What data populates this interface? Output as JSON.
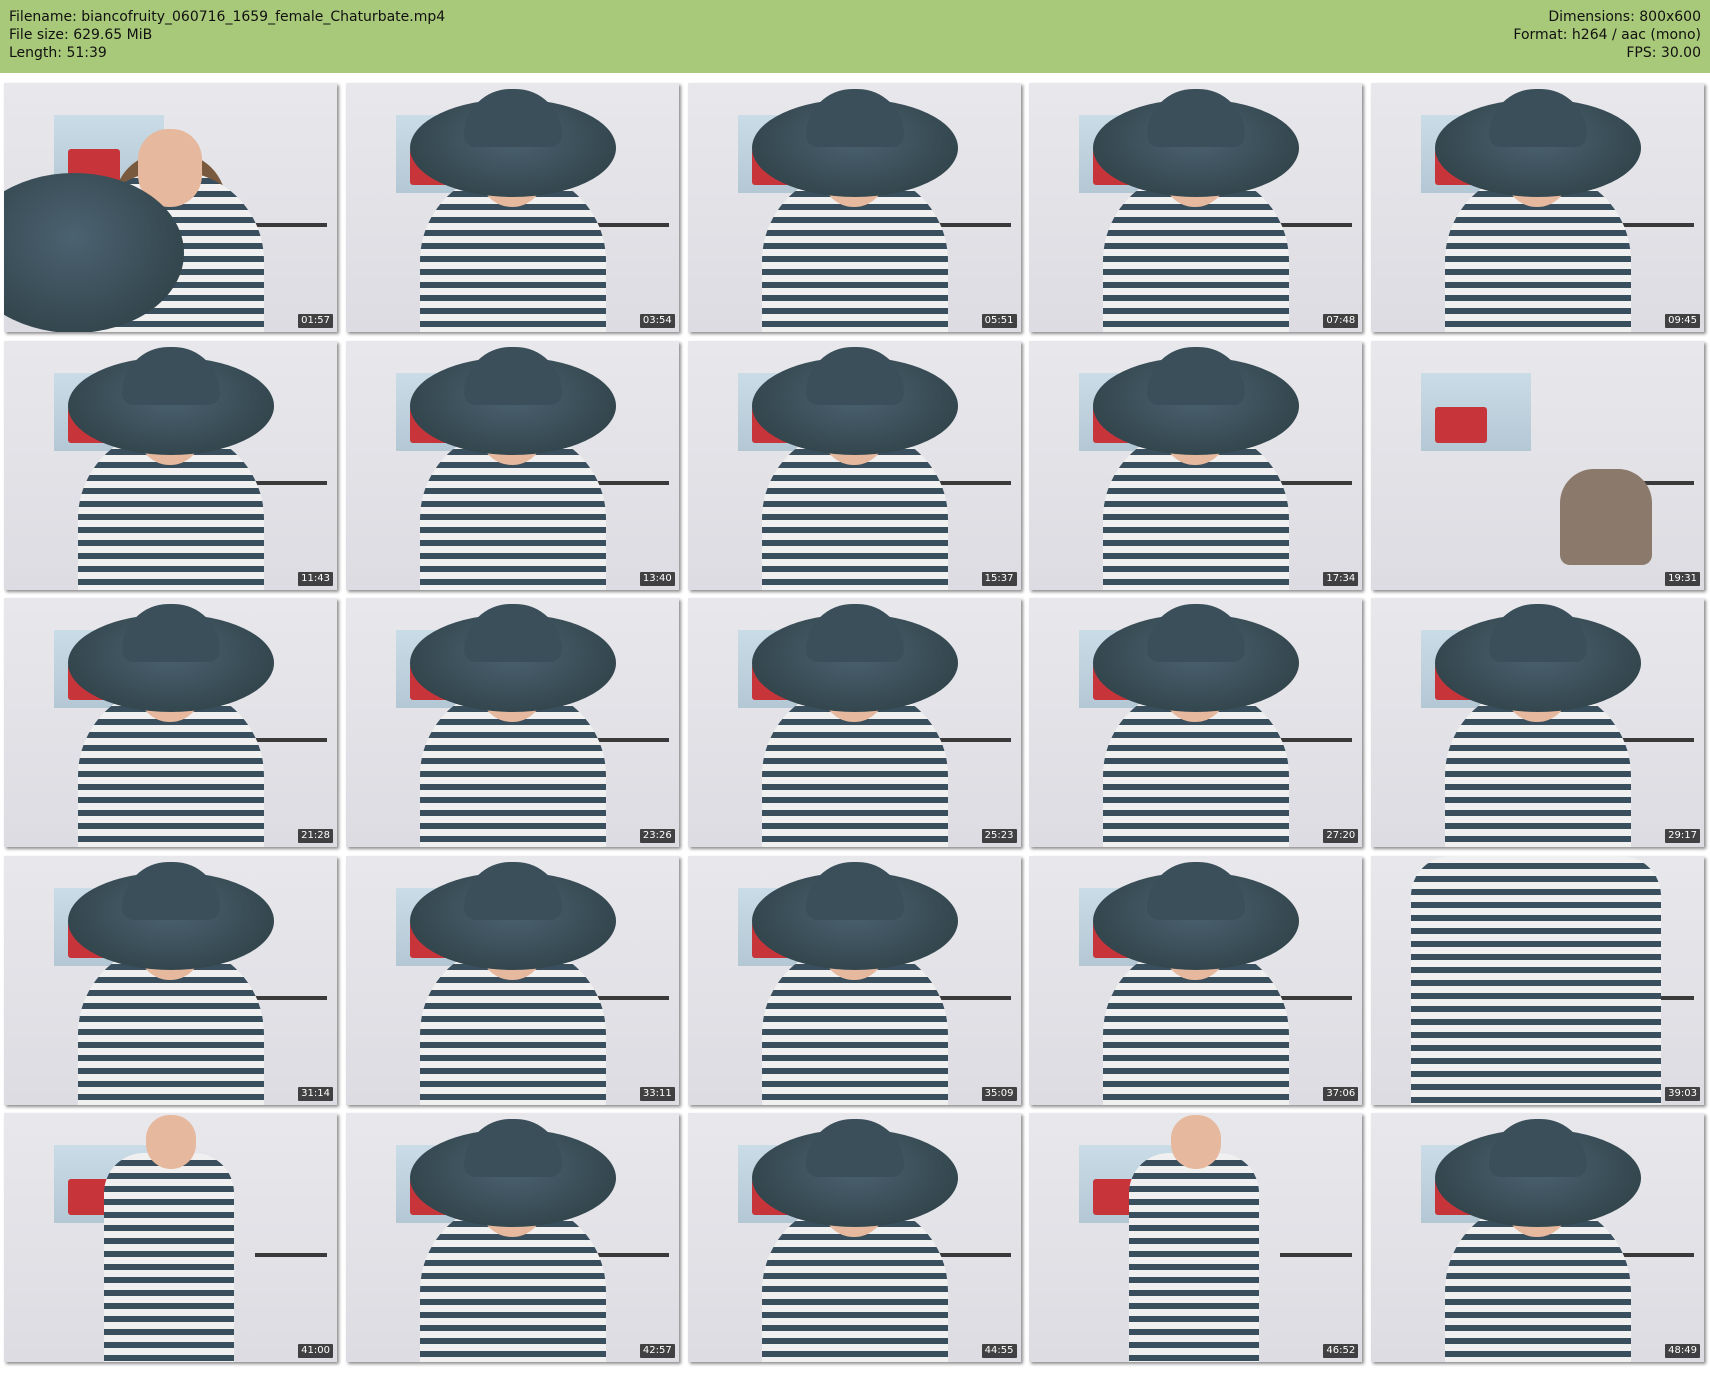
{
  "header": {
    "filename": "Filename: biancofruity_060716_1659_female_Chaturbate.mp4",
    "filesize": "File size: 629.65 MiB",
    "length": "Length: 51:39",
    "dimensions": "Dimensions: 800x600",
    "format": "Format: h264 / aac (mono)",
    "fps": "FPS: 30.00"
  },
  "thumbnails": [
    {
      "time": "01:57",
      "scene": "hat-closeup"
    },
    {
      "time": "03:54",
      "scene": "hat-person"
    },
    {
      "time": "05:51",
      "scene": "hat-person"
    },
    {
      "time": "07:48",
      "scene": "hat-person"
    },
    {
      "time": "09:45",
      "scene": "hat-person"
    },
    {
      "time": "11:43",
      "scene": "hat-person"
    },
    {
      "time": "13:40",
      "scene": "hat-person"
    },
    {
      "time": "15:37",
      "scene": "hat-person"
    },
    {
      "time": "17:34",
      "scene": "hat-person"
    },
    {
      "time": "19:31",
      "scene": "empty-chair"
    },
    {
      "time": "21:28",
      "scene": "hat-person"
    },
    {
      "time": "23:26",
      "scene": "hat-person"
    },
    {
      "time": "25:23",
      "scene": "hat-person"
    },
    {
      "time": "27:20",
      "scene": "hat-person"
    },
    {
      "time": "29:17",
      "scene": "hat-person"
    },
    {
      "time": "31:14",
      "scene": "hat-person"
    },
    {
      "time": "33:11",
      "scene": "hat-person"
    },
    {
      "time": "35:09",
      "scene": "hat-person"
    },
    {
      "time": "37:06",
      "scene": "hat-person"
    },
    {
      "time": "39:03",
      "scene": "shirt-closeup"
    },
    {
      "time": "41:00",
      "scene": "standing-person"
    },
    {
      "time": "42:57",
      "scene": "hat-person"
    },
    {
      "time": "44:55",
      "scene": "hat-person"
    },
    {
      "time": "46:52",
      "scene": "standing-person"
    },
    {
      "time": "48:49",
      "scene": "hat-person"
    }
  ],
  "colors": {
    "header_bg": "#a9c97a",
    "timestamp_bg": "#141414",
    "timestamp_text": "#ffffff"
  }
}
